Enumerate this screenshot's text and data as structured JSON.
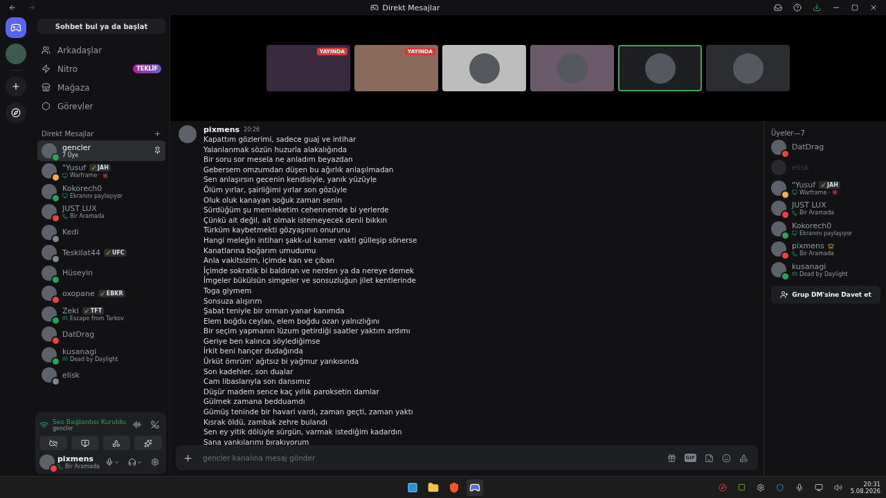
{
  "window": {
    "title": "Direkt Mesajlar"
  },
  "sidebar": {
    "search": "Sohbet bul ya da başlat",
    "nav": [
      {
        "kind": "friends",
        "label": "Arkadaşlar"
      },
      {
        "kind": "nitro",
        "label": "Nitro",
        "badge": "TEKLİF"
      },
      {
        "kind": "shop",
        "label": "Mağaza"
      },
      {
        "kind": "quests",
        "label": "Görevler"
      }
    ],
    "dm_header": "Direkt Mesajlar",
    "dms": [
      {
        "name": "gencler",
        "subtitle": "7 Üye",
        "color": "#23a55a",
        "selected": true,
        "pinned": true
      },
      {
        "name": "\"Yusuf",
        "tag": "JAH",
        "color": "#f0b232",
        "selected": false,
        "pinned": false,
        "activity": {
          "kind": "game",
          "text": "Warframe ·"
        }
      },
      {
        "name": "Kokorech0",
        "color": "#23a55a",
        "selected": false,
        "pinned": false,
        "activity": {
          "kind": "screen",
          "text": "Ekranını paylaşıyor"
        }
      },
      {
        "name": "JUST LUX",
        "color": "#f23f43",
        "selected": false,
        "pinned": false,
        "activity": {
          "kind": "call",
          "text": "Bir Aramada"
        }
      },
      {
        "name": "Kedi",
        "color": "#80848e",
        "selected": false,
        "pinned": false
      },
      {
        "name": "Teskilat44",
        "tag": "UFC",
        "color": "#80848e",
        "selected": false,
        "pinned": false
      },
      {
        "name": "Hüseyin",
        "color": "#23a55a",
        "selected": false,
        "pinned": false
      },
      {
        "name": "oxopane",
        "tag": "EBKR",
        "color": "#f23f43",
        "selected": false,
        "pinned": false
      },
      {
        "name": "Zeki",
        "tag": "TFT",
        "color": "#23a55a",
        "selected": false,
        "pinned": false,
        "activity": {
          "kind": "controller",
          "text": "Escape from Tarkov"
        }
      },
      {
        "name": "DatDrag",
        "color": "#f23f43",
        "selected": false,
        "pinned": false
      },
      {
        "name": "kusanagi",
        "color": "#23a55a",
        "selected": false,
        "pinned": false,
        "activity": {
          "kind": "controller",
          "text": "Dead by Daylight"
        }
      },
      {
        "name": "elisk",
        "color": "#80848e",
        "selected": false,
        "pinned": false
      }
    ],
    "voice": {
      "title": "Ses Bağlantısı Kuruldu",
      "channel": "gencler"
    },
    "user": {
      "name": "pixmens",
      "color": "#f23f43",
      "activity": {
        "kind": "call",
        "text": "Bir Aramada"
      }
    }
  },
  "streams": [
    {
      "live": true,
      "selected": false,
      "color": "#3a2a40",
      "badge": "YAYINDA"
    },
    {
      "live": true,
      "selected": false,
      "color": "#8a6a5a",
      "badge": "YAYINDA"
    },
    {
      "live": false,
      "selected": false,
      "color": "#bdbdbd"
    },
    {
      "live": false,
      "selected": false,
      "color": "#6b5a6a"
    },
    {
      "live": false,
      "selected": true,
      "color": "#1e1f22"
    },
    {
      "live": false,
      "selected": false,
      "color": "#2b2d31"
    }
  ],
  "message": {
    "author": "pixmens",
    "time": "20:26",
    "lines": [
      "Kapattım gözlerimi, sadece guaj ve intihar",
      "Yalanlanmak sözün huzurla alakalığında",
      "Bir soru sor mesela ne anladım beyazdan",
      "Gebersem omzumdan düşen bu ağırlık anlaşılmadan",
      "Sen anlaşırsın gecenin kendisiyle, yanık yüzüyle",
      "Ölüm yırlar, şairliğimi yırlar son gözüyle",
      "Oluk oluk kanayan soğuk zaman senin",
      "Sürdüğüm şu memleketim cehennemde bi yerlerde",
      "Çünkü ait değil, ait olmak istemeyecek denli bıkkın",
      "Türküm kaybetmekti gözyaşının onurunu",
      "Hangi meleğin intiharı şakk-ul kamer vakti gülleşip sönerse",
      "Kanatlarına boğarım umudumu",
      "Anla vakitsizim, içimde kan ve çıban",
      "İçimde sokratik bi baldıran ve nerden ya da nereye demek",
      "İmgeler bükülsün simgeler ve sonsuzluğun jilet kentlerinde",
      "Toga giymem",
      "Sonsuza alışırım",
      "Şabat teniyle bir orman yanar kanımda",
      "Elem boğdu ceylan, elem boğdu ozan yalnızlığını",
      "Bir seçim yapmanın lüzum getirdiği saatler yaktım ardımı",
      "Geriye ben kalınca söylediğimse",
      "İrkit beni hançer dudağında",
      "Ürküt ömrüm' ağıtsız bi yağmur yankısında",
      "Son kadehler, son dualar",
      "Cam libaslarıyla son dansımız",
      "Düşür madem sence kaç yıllık paroksetin damlar",
      "Gülmek zamana bedduamdı",
      "Gümüş teninde bir havari vardı, zaman geçti, zaman yaktı",
      "Kısrak öldü, zambak zehre bulandı",
      "Sen ey yitik dölüyle sürgün, varmak istediğim kadardın",
      "Sana yankılarımı bırakıyorum"
    ]
  },
  "composer": {
    "placeholder": "gencler kanalına mesaj gönder",
    "gif": "GIF"
  },
  "members": {
    "header": "Üyeler—7",
    "items": [
      {
        "name": "DatDrag",
        "color": "#f23f43",
        "faded": false,
        "owner": false
      },
      {
        "name": "elisk",
        "faded": true,
        "owner": false
      },
      {
        "name": "\"Yusuf",
        "tag": "JAH",
        "color": "#f0b232",
        "faded": false,
        "owner": false,
        "activity": {
          "kind": "game",
          "text": "Warframe ·"
        }
      },
      {
        "name": "JUST LUX",
        "color": "#f23f43",
        "faded": false,
        "owner": false,
        "activity": {
          "kind": "call",
          "text": "Bir Aramada"
        }
      },
      {
        "name": "Kokorech0",
        "color": "#23a55a",
        "faded": false,
        "owner": false,
        "activity": {
          "kind": "screen",
          "text": "Ekranını paylaşıyor"
        }
      },
      {
        "name": "pixmens",
        "color": "#f23f43",
        "faded": false,
        "owner": true,
        "activity": {
          "kind": "call",
          "text": "Bir Aramada"
        }
      },
      {
        "name": "kusanagi",
        "color": "#23a55a",
        "faded": false,
        "owner": false,
        "activity": {
          "kind": "controller",
          "text": "Dead by Daylight"
        }
      }
    ],
    "invite": "Grup DM'sine Davet et"
  },
  "taskbar": {
    "time": "20:31",
    "date": "5.08.2026"
  }
}
